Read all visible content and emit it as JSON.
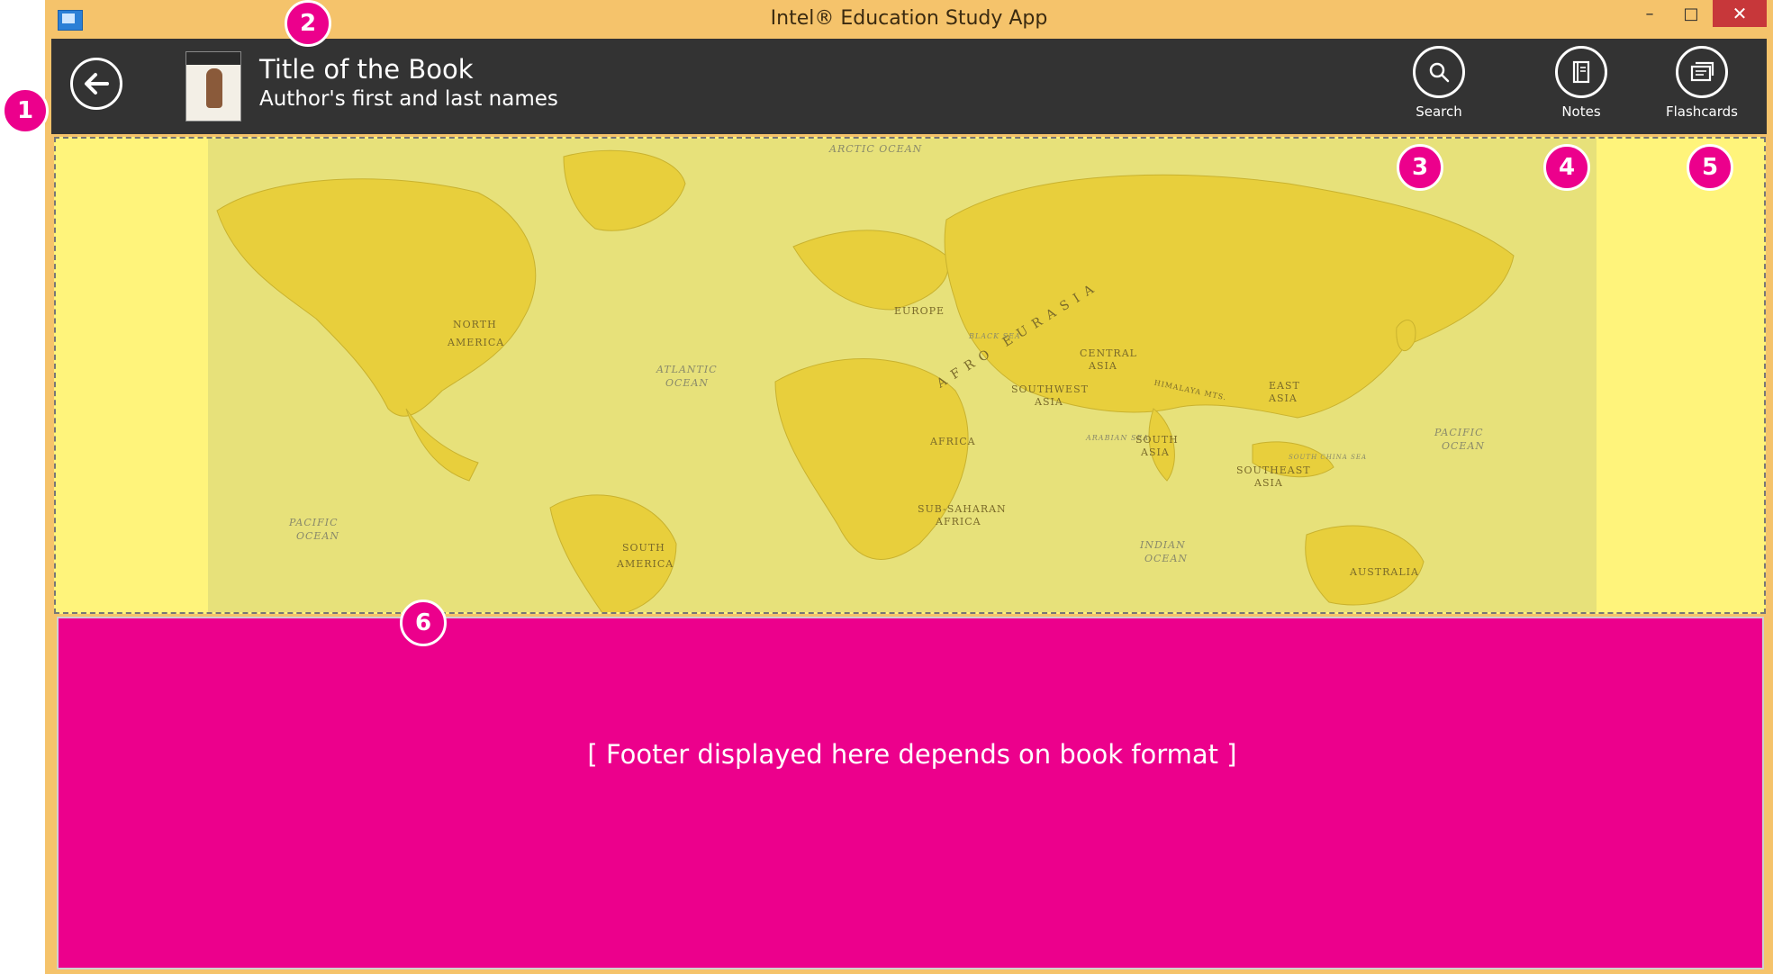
{
  "window": {
    "title": "Intel® Education Study App",
    "minimize_glyph": "–",
    "maximize_glyph": "□",
    "close_glyph": "✕"
  },
  "header": {
    "book_title": "Title of the Book",
    "book_author": "Author's first and last names",
    "tools": [
      {
        "label": "Search",
        "icon": "search-icon"
      },
      {
        "label": "Notes",
        "icon": "notes-icon"
      },
      {
        "label": "Flashcards",
        "icon": "flashcards-icon"
      }
    ]
  },
  "map": {
    "labels": {
      "arctic_ocean": "ARCTIC OCEAN",
      "north": "NORTH",
      "america": "AMERICA",
      "atlantic": "ATLANTIC",
      "ocean": "OCEAN",
      "europe": "EUROPE",
      "eurasia": "AFRO EURASIA",
      "black_sea": "BLACK SEA",
      "central": "CENTRAL",
      "asia": "ASIA",
      "southwest": "SOUTHWEST",
      "africa": "AFRICA",
      "arabian_sea": "ARABIAN SEA",
      "south": "SOUTH",
      "east": "EAST",
      "southeast": "SOUTHEAST",
      "south_china_sea": "SOUTH CHINA SEA",
      "sub_saharan": "SUB-SAHARAN",
      "pacific": "PACIFIC",
      "indian": "INDIAN",
      "australia": "AUSTRALIA",
      "himalaya": "HIMALAYA MTS."
    }
  },
  "footer": {
    "placeholder": "[ Footer displayed here depends on book format ]"
  },
  "markers": [
    "1",
    "2",
    "3",
    "4",
    "5",
    "6"
  ],
  "colors": {
    "accent": "#ec008c",
    "header_bg": "#333333",
    "window_frame": "#f5c36b",
    "content_bg": "#fff47b"
  }
}
